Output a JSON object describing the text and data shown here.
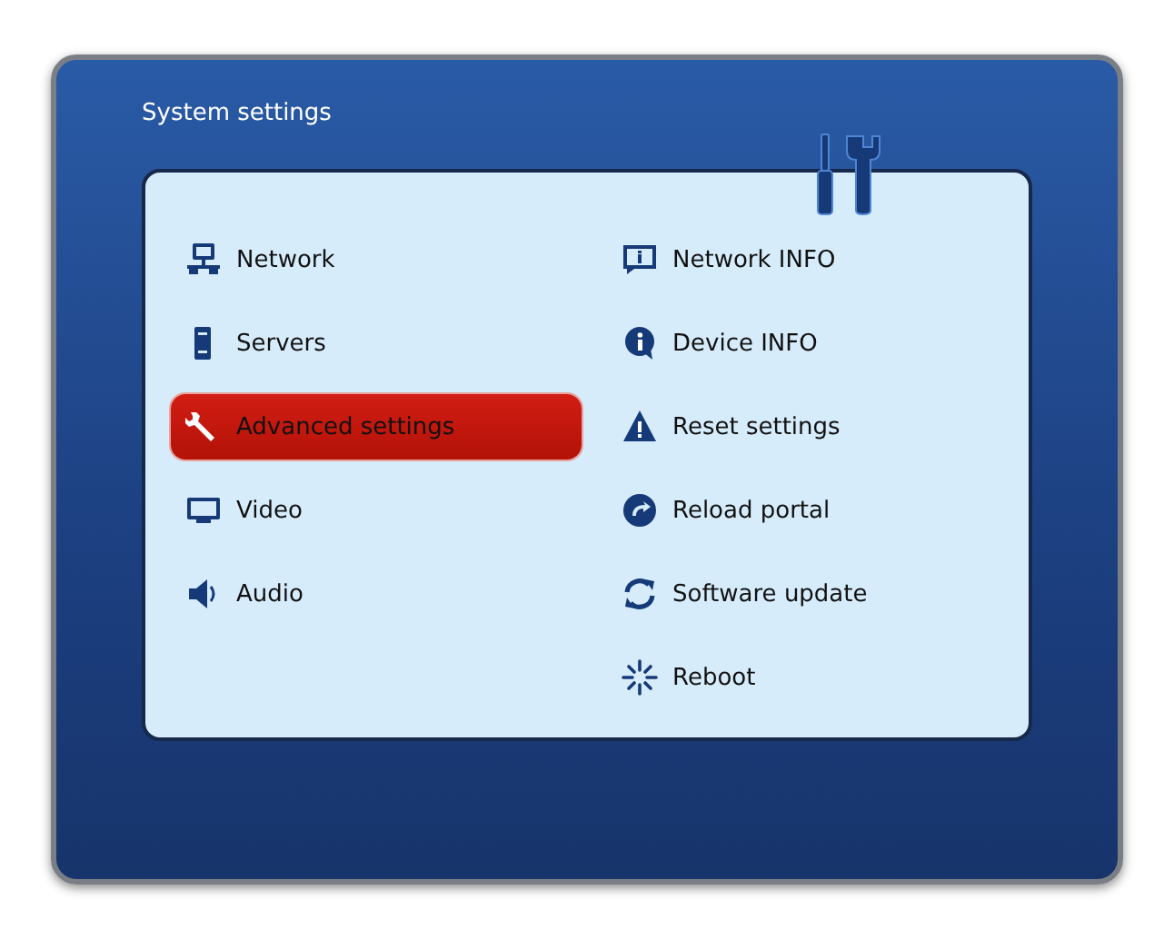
{
  "window": {
    "title": "System settings"
  },
  "columns": [
    {
      "items": [
        {
          "label": "Network",
          "selected": false
        },
        {
          "label": "Servers",
          "selected": false
        },
        {
          "label": "Advanced settings",
          "selected": true
        },
        {
          "label": "Video",
          "selected": false
        },
        {
          "label": "Audio",
          "selected": false
        }
      ]
    },
    {
      "items": [
        {
          "label": "Network INFO",
          "selected": false
        },
        {
          "label": "Device INFO",
          "selected": false
        },
        {
          "label": "Reset settings",
          "selected": false
        },
        {
          "label": "Reload portal",
          "selected": false
        },
        {
          "label": "Software update",
          "selected": false
        },
        {
          "label": "Reboot",
          "selected": false
        }
      ]
    }
  ]
}
